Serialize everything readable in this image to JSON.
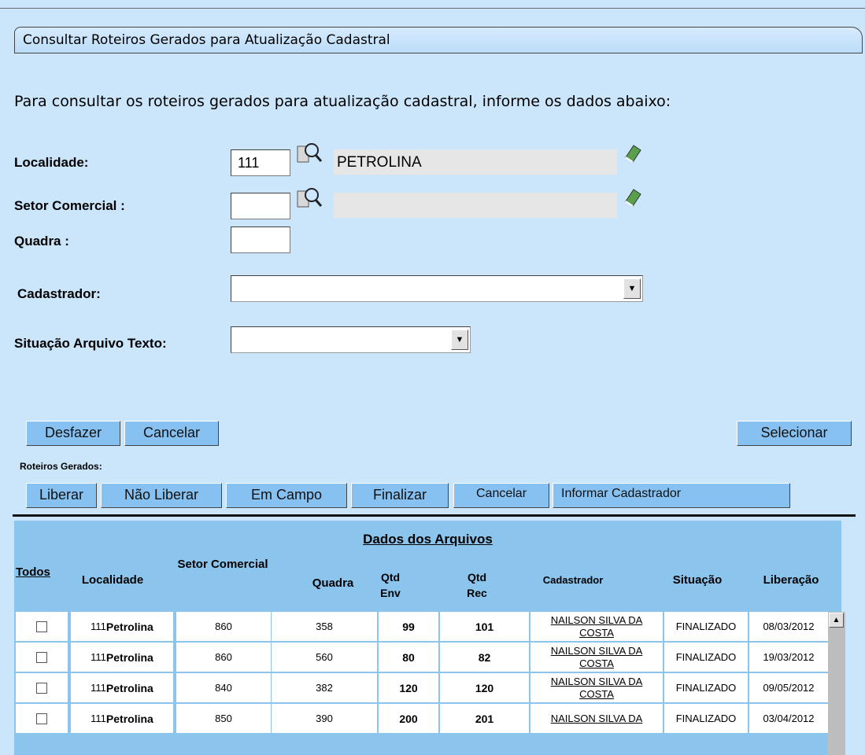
{
  "title": "Consultar Roteiros Gerados para Atualização Cadastral",
  "intro": "Para consultar os roteiros gerados para atualização cadastral, informe os dados abaixo:",
  "form": {
    "localidade_label": "Localidade:",
    "localidade_code": "111",
    "localidade_desc": "PETROLINA",
    "setor_label": "Setor Comercial :",
    "setor_code": "",
    "setor_desc": "",
    "quadra_label": "Quadra :",
    "quadra_value": "",
    "cadastrador_label": "Cadastrador:",
    "cadastrador_value": "",
    "situacao_label": "Situação Arquivo Texto:",
    "situacao_value": ""
  },
  "buttons": {
    "desfazer": "Desfazer",
    "cancelar": "Cancelar",
    "selecionar": "Selecionar",
    "liberar": "Liberar",
    "nao_liberar": "Não Liberar",
    "em_campo": "Em Campo",
    "finalizar": "Finalizar",
    "cancelar2": "Cancelar",
    "informar": "Informar Cadastrador"
  },
  "section_label": "Roteiros Gerados:",
  "table": {
    "title": "Dados dos Arquivos",
    "headers": {
      "todos": "Todos",
      "localidade": "Localidade",
      "setor": "Setor Comercial",
      "quadra": "Quadra",
      "qtd_env": "Qtd Env",
      "qtd_rec": "Qtd Rec",
      "cadastrador": "Cadastrador",
      "situacao": "Situação",
      "liberacao": "Liberação"
    },
    "rows": [
      {
        "loc_code": "111",
        "loc_name": "Petrolina",
        "setor": "860",
        "quadra": "358",
        "env": "99",
        "rec": "101",
        "cad": "NAILSON SILVA DA COSTA",
        "sit": "FINALIZADO",
        "lib": "08/03/2012"
      },
      {
        "loc_code": "111",
        "loc_name": "Petrolina",
        "setor": "860",
        "quadra": "560",
        "env": "80",
        "rec": "82",
        "cad": "NAILSON SILVA DA COSTA",
        "sit": "FINALIZADO",
        "lib": "19/03/2012"
      },
      {
        "loc_code": "111",
        "loc_name": "Petrolina",
        "setor": "840",
        "quadra": "382",
        "env": "120",
        "rec": "120",
        "cad": "NAILSON SILVA DA COSTA",
        "sit": "FINALIZADO",
        "lib": "09/05/2012"
      },
      {
        "loc_code": "111",
        "loc_name": "Petrolina",
        "setor": "850",
        "quadra": "390",
        "env": "200",
        "rec": "201",
        "cad": "NAILSON SILVA DA",
        "sit": "FINALIZADO",
        "lib": "03/04/2012"
      }
    ]
  }
}
